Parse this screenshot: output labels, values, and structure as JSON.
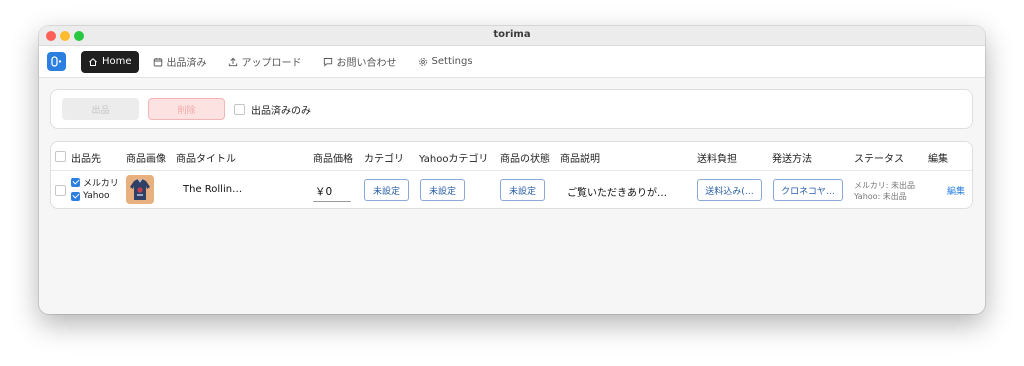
{
  "window": {
    "title": "torima"
  },
  "nav": {
    "items": [
      {
        "label": "Home",
        "icon": "home-icon",
        "active": true
      },
      {
        "label": "出品済み",
        "icon": "calendar-icon",
        "active": false
      },
      {
        "label": "アップロード",
        "icon": "upload-icon",
        "active": false
      },
      {
        "label": "お問い合わせ",
        "icon": "chat-icon",
        "active": false
      },
      {
        "label": "Settings",
        "icon": "gear-icon",
        "active": false
      }
    ]
  },
  "toolbar": {
    "publish_label": "出品",
    "delete_label": "削除",
    "filter_label": "出品済みのみ",
    "filter_checked": false
  },
  "table": {
    "headers": {
      "destination": "出品先",
      "image": "商品画像",
      "title": "商品タイトル",
      "price": "商品価格",
      "category": "カテゴリ",
      "yahoo_category": "Yahooカテゴリ",
      "condition": "商品の状態",
      "description": "商品説明",
      "shipping_fee": "送料負担",
      "shipping_method": "発送方法",
      "status": "ステータス",
      "edit": "編集"
    },
    "rows": [
      {
        "selected": false,
        "destinations": [
          {
            "label": "メルカリ",
            "checked": true
          },
          {
            "label": "Yahoo",
            "checked": true
          }
        ],
        "title": "The Rollin…",
        "price": "￥0",
        "category": "未設定",
        "yahoo_category": "未設定",
        "condition": "未設定",
        "description": "ご覧いただきありが…",
        "shipping_fee": "送料込み(…",
        "shipping_method": "クロネコヤ…",
        "status_lines": [
          "メルカリ: 未出品",
          "Yahoo: 未出品"
        ],
        "edit_label": "編集"
      }
    ]
  },
  "colors": {
    "accent": "#2a7fe0",
    "nav_active_bg": "#1f1f1f",
    "delete_bg": "#fde2e2"
  }
}
